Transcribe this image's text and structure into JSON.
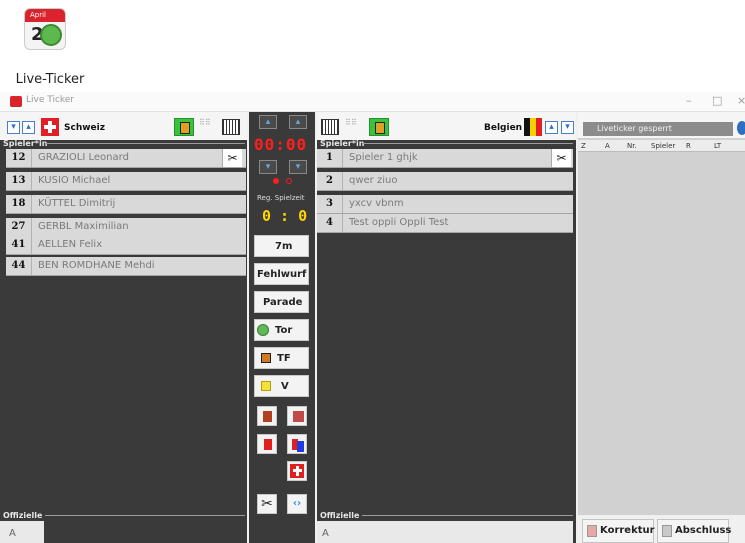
{
  "desktop": {
    "icon_label": "Live-Ticker",
    "calendar_month": "April",
    "calendar_day": "20"
  },
  "window": {
    "title": "Live Ticker",
    "minimize": "–",
    "maximize": "□",
    "close": "×"
  },
  "home": {
    "team": "Schweiz",
    "players_label": "Spieler*in",
    "players": [
      {
        "num": "12",
        "name": "GRAZIOLI Leonard",
        "keeper": true
      },
      {
        "num": "13",
        "name": "KUSIO Michael",
        "keeper": false
      },
      {
        "num": "18",
        "name": "KÜTTEL Dimitrij",
        "keeper": false
      },
      {
        "num": "27",
        "name": "GERBL Maximilian",
        "keeper": false
      },
      {
        "num": "41",
        "name": "AELLEN Felix",
        "keeper": false
      },
      {
        "num": "44",
        "name": "BEN ROMDHANE Mehdi",
        "keeper": false
      }
    ],
    "officials_label": "Offizielle",
    "official_value": "A"
  },
  "away": {
    "team": "Belgien",
    "players_label": "Spieler*in",
    "players": [
      {
        "num": "1",
        "name": "Spieler 1 ghjk",
        "keeper": true
      },
      {
        "num": "2",
        "name": "qwer ziuo",
        "keeper": false
      },
      {
        "num": "3",
        "name": "yxcv vbnm",
        "keeper": false
      },
      {
        "num": "4",
        "name": "Test oppli Oppli Test",
        "keeper": false
      }
    ],
    "officials_label": "Offizielle",
    "official_value": "A"
  },
  "center": {
    "timer_digits": "00:00",
    "reg_label": "Reg. Spielzeit",
    "score": "0 : 0",
    "buttons": {
      "seven_m": "7m",
      "fehlwurf": "Fehlwurf",
      "parade": "Parade",
      "tor": "Tor",
      "tf": "TF",
      "v": "V"
    },
    "colors": {
      "red": "#ff1e1e",
      "yellow_score": "#ffd400"
    }
  },
  "ticker": {
    "locked_label": "Liveticker gesperrt",
    "columns": [
      "Z",
      "A",
      "Nr.",
      "Spieler",
      "R",
      "LT"
    ],
    "korrektur": "Korrektur",
    "abschluss": "Abschluss"
  },
  "icons": {
    "home_arrows": [
      "chevron-down-icon",
      "chevron-up-icon"
    ],
    "keeper": "goalkeeper-icon",
    "gate": "goal-gate-icon"
  }
}
